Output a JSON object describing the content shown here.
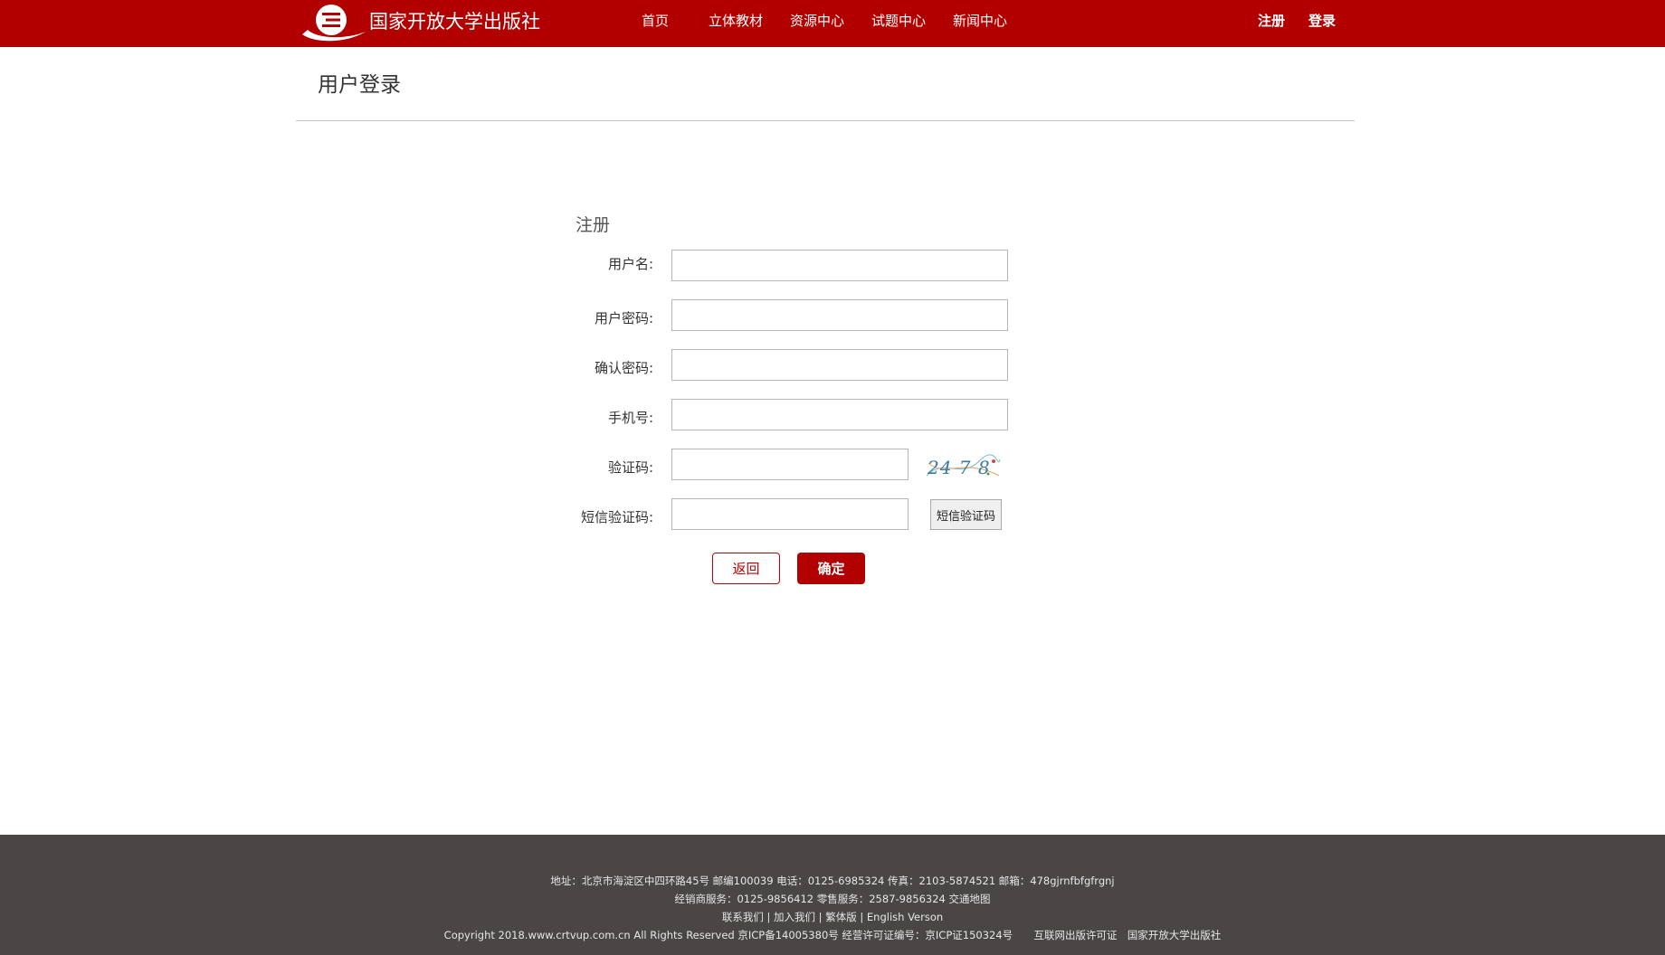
{
  "header": {
    "site_title": "国家开放大学出版社",
    "nav": [
      "首页",
      "立体教材",
      "资源中心",
      "试题中心",
      "新闻中心"
    ],
    "register": "注册",
    "login": "登录"
  },
  "page_title": "用户登录",
  "form": {
    "heading": "注册",
    "fields": {
      "username": {
        "label": "用户名:",
        "value": ""
      },
      "password": {
        "label": "用户密码:",
        "value": ""
      },
      "confirm_password": {
        "label": "确认密码:",
        "value": ""
      },
      "phone": {
        "label": "手机号:",
        "value": ""
      },
      "captcha": {
        "label": "验证码:",
        "value": ""
      },
      "sms_code": {
        "label": "短信验证码:",
        "value": ""
      }
    },
    "captcha_text": "24 7 8",
    "sms_button": "短信验证码",
    "back_button": "返回",
    "confirm_button": "确定"
  },
  "footer": {
    "address": "地址：北京市海淀区中四环路45号 邮编100039 电话：0125-6985324 传真：2103-5874521  邮箱：478gjrnfbfgfrgnj",
    "services": "经销商服务：0125-9856412 零售服务：2587-9856324 交通地图",
    "links": [
      "联系我们",
      "加入我们",
      "繁体版",
      "English Verson"
    ],
    "link_separator": " | ",
    "copyright": "Copyright 2018.www.crtvup.com.cn All Rights Reserved 京ICP备14005380号 经营许可证编号：京ICP证150324号",
    "license": "互联网出版许可证",
    "publisher": "国家开放大学出版社"
  },
  "colors": {
    "brand_red": "#b20000",
    "footer_bg": "#4a4646"
  },
  "icons": {
    "logo": "globe-logo-icon"
  }
}
